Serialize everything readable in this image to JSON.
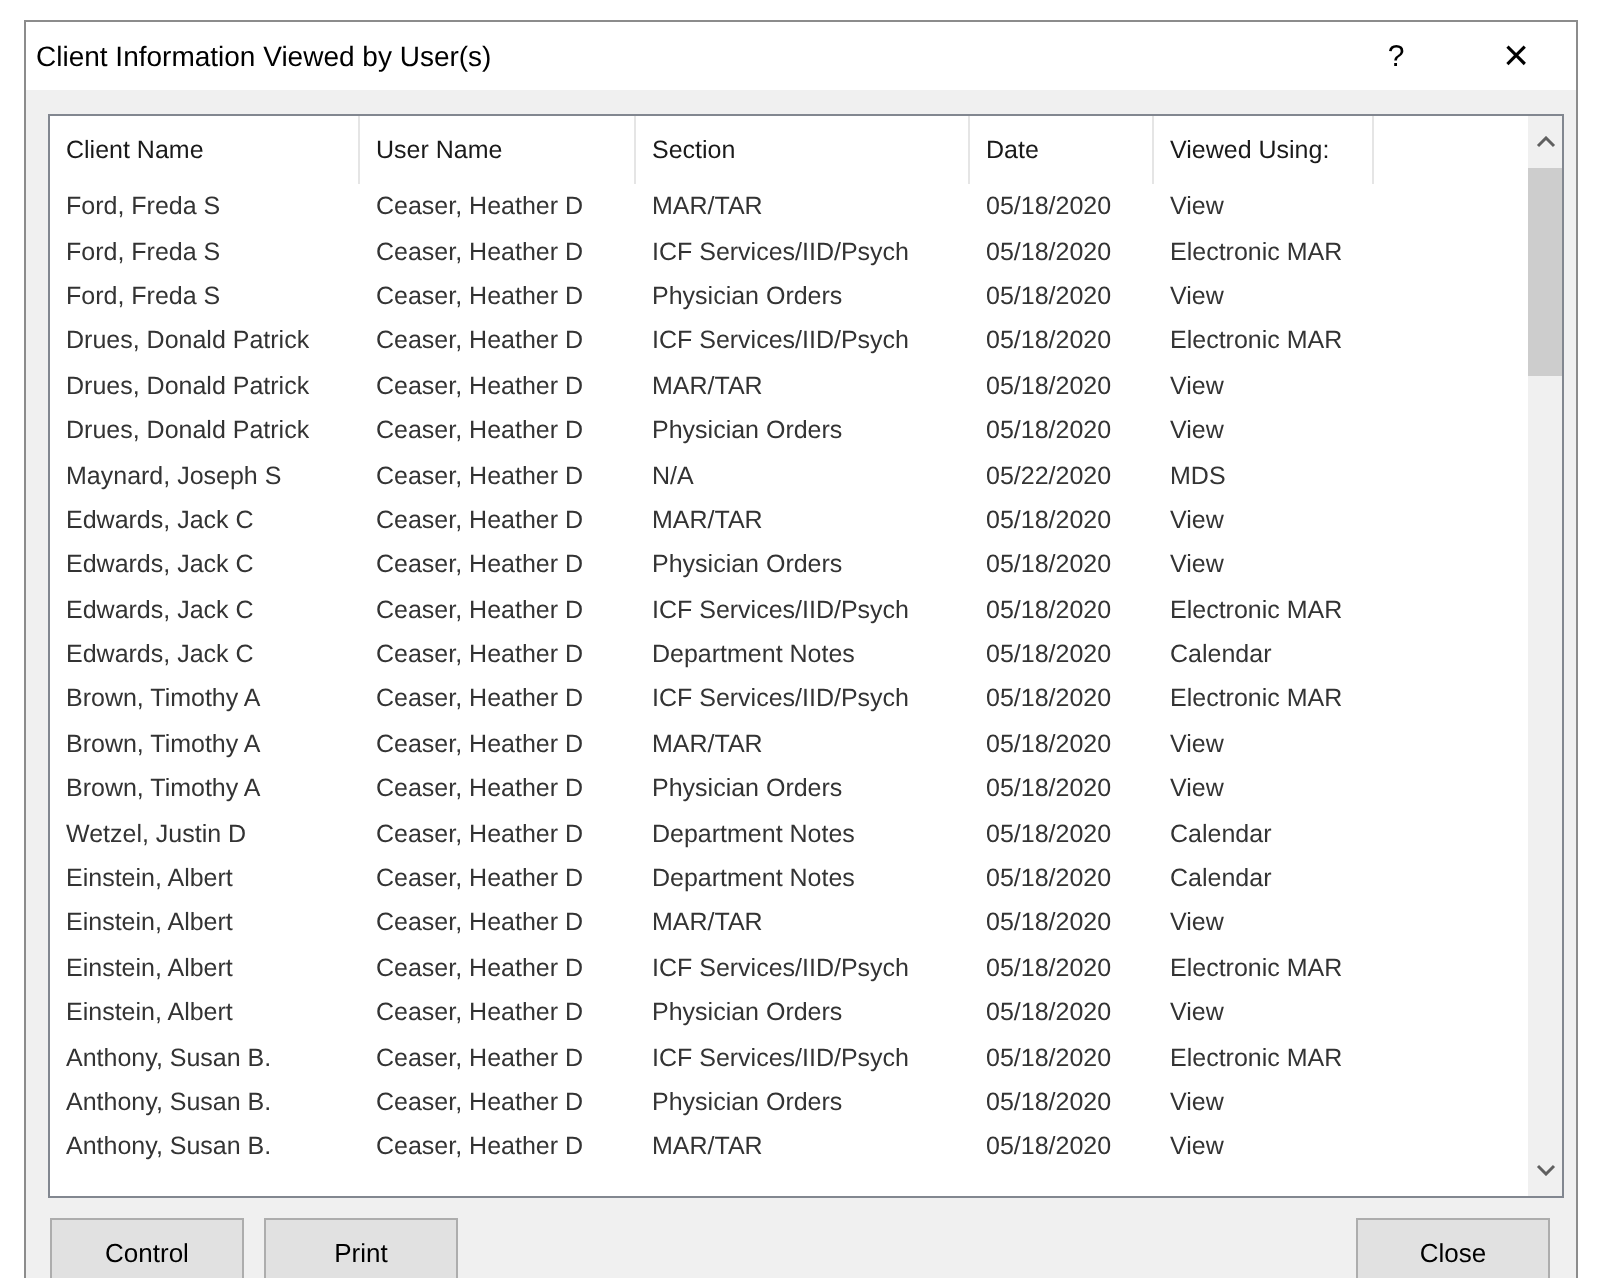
{
  "window": {
    "title": "Client Information Viewed by User(s)",
    "help": "?",
    "close": "×"
  },
  "table": {
    "columns": [
      "Client Name",
      "User Name",
      "Section",
      "Date",
      "Viewed Using:"
    ],
    "rows": [
      [
        "Ford, Freda S",
        "Ceaser, Heather D",
        "MAR/TAR",
        "05/18/2020",
        "View"
      ],
      [
        "Ford, Freda S",
        "Ceaser, Heather D",
        "ICF Services/IID/Psych",
        "05/18/2020",
        "Electronic MAR"
      ],
      [
        "Ford, Freda S",
        "Ceaser, Heather D",
        "Physician Orders",
        "05/18/2020",
        "View"
      ],
      [
        "Drues, Donald Patrick",
        "Ceaser, Heather D",
        "ICF Services/IID/Psych",
        "05/18/2020",
        "Electronic MAR"
      ],
      [
        "Drues, Donald Patrick",
        "Ceaser, Heather D",
        "MAR/TAR",
        "05/18/2020",
        "View"
      ],
      [
        "Drues, Donald Patrick",
        "Ceaser, Heather D",
        "Physician Orders",
        "05/18/2020",
        "View"
      ],
      [
        "Maynard, Joseph S",
        "Ceaser, Heather D",
        "N/A",
        "05/22/2020",
        "MDS"
      ],
      [
        "Edwards, Jack C",
        "Ceaser, Heather D",
        "MAR/TAR",
        "05/18/2020",
        "View"
      ],
      [
        "Edwards, Jack C",
        "Ceaser, Heather D",
        "Physician Orders",
        "05/18/2020",
        "View"
      ],
      [
        "Edwards, Jack C",
        "Ceaser, Heather D",
        "ICF Services/IID/Psych",
        "05/18/2020",
        "Electronic MAR"
      ],
      [
        "Edwards, Jack C",
        "Ceaser, Heather D",
        "Department Notes",
        "05/18/2020",
        "Calendar"
      ],
      [
        "Brown, Timothy A",
        "Ceaser, Heather D",
        "ICF Services/IID/Psych",
        "05/18/2020",
        "Electronic MAR"
      ],
      [
        "Brown, Timothy A",
        "Ceaser, Heather D",
        "MAR/TAR",
        "05/18/2020",
        "View"
      ],
      [
        "Brown, Timothy A",
        "Ceaser, Heather D",
        "Physician Orders",
        "05/18/2020",
        "View"
      ],
      [
        "Wetzel, Justin D",
        "Ceaser, Heather D",
        "Department Notes",
        "05/18/2020",
        "Calendar"
      ],
      [
        "Einstein, Albert",
        "Ceaser, Heather D",
        "Department Notes",
        "05/18/2020",
        "Calendar"
      ],
      [
        "Einstein, Albert",
        "Ceaser, Heather D",
        "MAR/TAR",
        "05/18/2020",
        "View"
      ],
      [
        "Einstein, Albert",
        "Ceaser, Heather D",
        "ICF Services/IID/Psych",
        "05/18/2020",
        "Electronic MAR"
      ],
      [
        "Einstein, Albert",
        "Ceaser, Heather D",
        "Physician Orders",
        "05/18/2020",
        "View"
      ],
      [
        "Anthony, Susan B.",
        "Ceaser, Heather D",
        "ICF Services/IID/Psych",
        "05/18/2020",
        "Electronic MAR"
      ],
      [
        "Anthony, Susan B.",
        "Ceaser, Heather D",
        "Physician Orders",
        "05/18/2020",
        "View"
      ],
      [
        "Anthony, Susan B.",
        "Ceaser, Heather D",
        "MAR/TAR",
        "05/18/2020",
        "View"
      ]
    ]
  },
  "buttons": {
    "left": [
      "Control",
      "Print"
    ],
    "right": [
      "Close"
    ]
  }
}
